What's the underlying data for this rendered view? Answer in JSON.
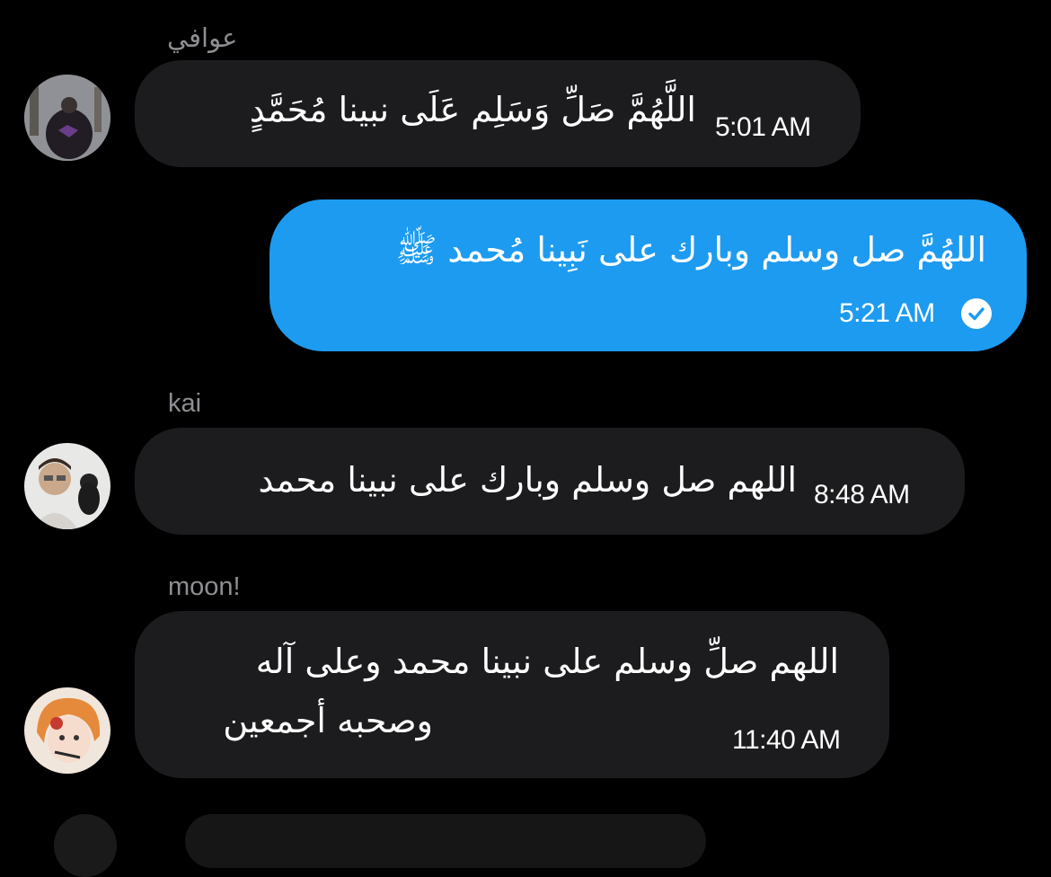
{
  "messages": [
    {
      "sender": "عوافي",
      "text": "اللَّهُمَّ صَلِّ وَسَلِم عَلَى نبينا مُحَمَّدٍ",
      "time": "5:01 AM"
    },
    {
      "sender": "",
      "text": "اللهُمَّ صل وسلم وبارك على نَبِينا مُحمد ﷺ",
      "time": "5:21 AM",
      "status": "sent-check-icon"
    },
    {
      "sender": "kai",
      "text": "اللهم صل وسلم وبارك على نبينا محمد",
      "time": "8:48 AM"
    },
    {
      "sender": "moon!",
      "text_line1": "اللهم صلِّ وسلم على نبينا محمد وعلى آله",
      "text_line2": "وصحبه أجمعين",
      "time": "11:40 AM"
    }
  ],
  "colors": {
    "background": "#000000",
    "incoming_bubble": "#1c1c1e",
    "outgoing_bubble": "#1d9bf0",
    "sender_label": "#8e8e93"
  }
}
